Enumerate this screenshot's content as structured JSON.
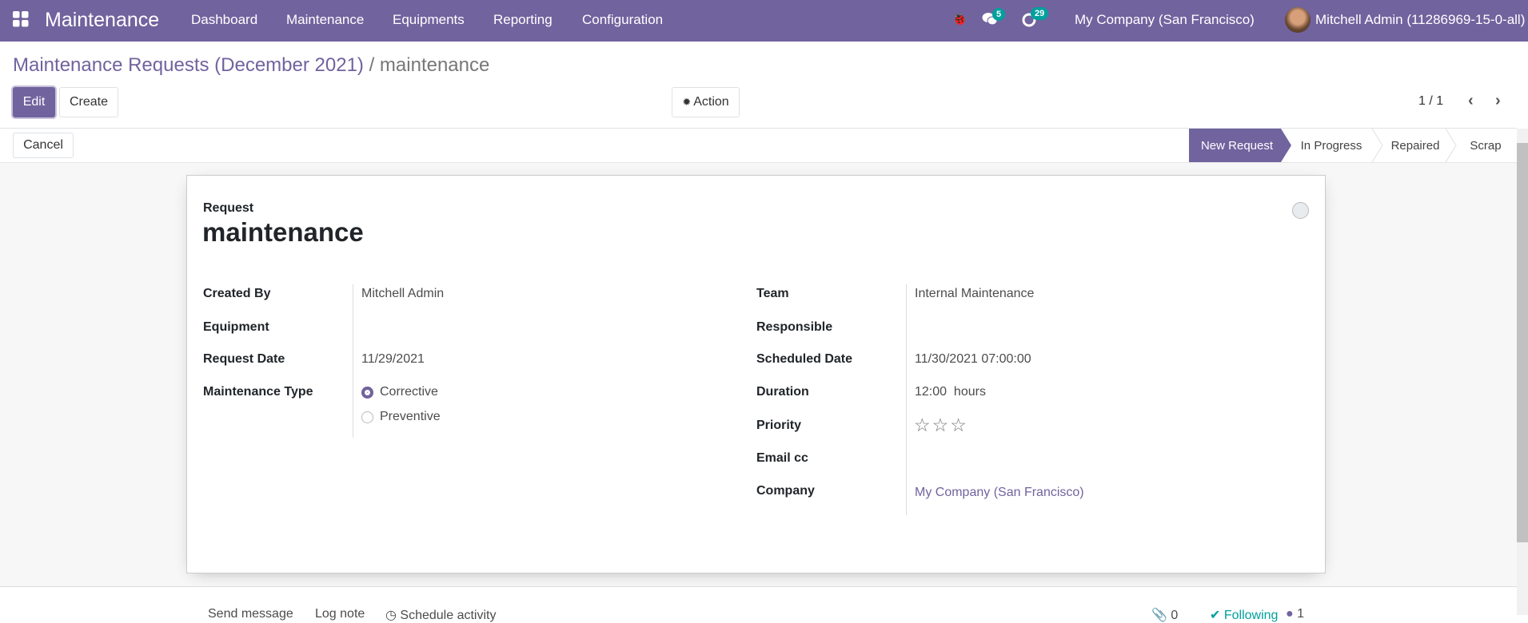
{
  "navbar": {
    "app_name": "Maintenance",
    "menu": [
      "Dashboard",
      "Maintenance",
      "Equipments",
      "Reporting",
      "Configuration"
    ],
    "messages_count": "5",
    "activities_count": "29",
    "company": "My Company (San Francisco)",
    "user": "Mitchell Admin (11286969-15-0-all)"
  },
  "breadcrumb": {
    "parent": "Maintenance Requests (December 2021)",
    "separator": "/",
    "current": "maintenance"
  },
  "control": {
    "edit": "Edit",
    "create": "Create",
    "action": "Action",
    "pager": "1 / 1",
    "cancel": "Cancel"
  },
  "stages": [
    "New Request",
    "In Progress",
    "Repaired",
    "Scrap"
  ],
  "form": {
    "request_label": "Request",
    "name": "maintenance",
    "left": [
      {
        "label": "Created By",
        "value": "Mitchell Admin"
      },
      {
        "label": "Equipment",
        "value": ""
      },
      {
        "label": "Request Date",
        "value": "11/29/2021"
      },
      {
        "label": "Maintenance Type",
        "value": ""
      }
    ],
    "maintenance_types": [
      "Corrective",
      "Preventive"
    ],
    "right": [
      {
        "label": "Team",
        "value": "Internal Maintenance"
      },
      {
        "label": "Responsible",
        "value": ""
      },
      {
        "label": "Scheduled Date",
        "value": "11/30/2021 07:00:00"
      },
      {
        "label": "Duration",
        "value": "12:00  hours"
      },
      {
        "label": "Priority",
        "value": ""
      },
      {
        "label": "Email cc",
        "value": ""
      },
      {
        "label": "Company",
        "value": "My Company (San Francisco)"
      }
    ]
  },
  "chatter": {
    "send_message": "Send message",
    "log_note": "Log note",
    "schedule_activity": "Schedule activity",
    "attachments": "0",
    "following": "Following",
    "followers": "1"
  },
  "colors": {
    "brand": "#71639e",
    "badge": "#00a09d"
  }
}
